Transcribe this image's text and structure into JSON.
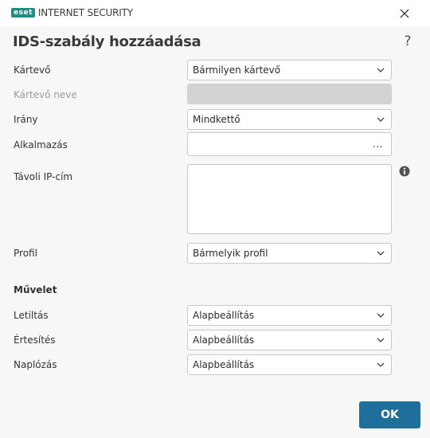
{
  "window": {
    "brand_badge": "eset",
    "product_name": "INTERNET SECURITY",
    "close_icon": "close-icon"
  },
  "dialog": {
    "title": "IDS-szabály hozzáadása",
    "help_label": "?"
  },
  "fields": {
    "malware": {
      "label": "Kártevő",
      "value": "Bármilyen kártevő"
    },
    "malware_name": {
      "label": "Kártevő neve",
      "value": ""
    },
    "direction": {
      "label": "Irány",
      "value": "Mindkettő"
    },
    "application": {
      "label": "Alkalmazás",
      "value": "",
      "browse_label": "..."
    },
    "remote_ip": {
      "label": "Távoli IP-cím",
      "value": "",
      "info_icon": "info-icon"
    },
    "profile": {
      "label": "Profil",
      "value": "Bármelyik profil"
    }
  },
  "action": {
    "section_label": "Művelet",
    "block": {
      "label": "Letiltás",
      "value": "Alapbeállítás"
    },
    "notify": {
      "label": "Értesítés",
      "value": "Alapbeállítás"
    },
    "log": {
      "label": "Naplózás",
      "value": "Alapbeállítás"
    }
  },
  "buttons": {
    "ok_label": "OK"
  },
  "colors": {
    "brand": "#1e8f84",
    "primary_button": "#1f6f9c",
    "disabled_field": "#d2d2d2",
    "background": "#f7f7f7"
  }
}
